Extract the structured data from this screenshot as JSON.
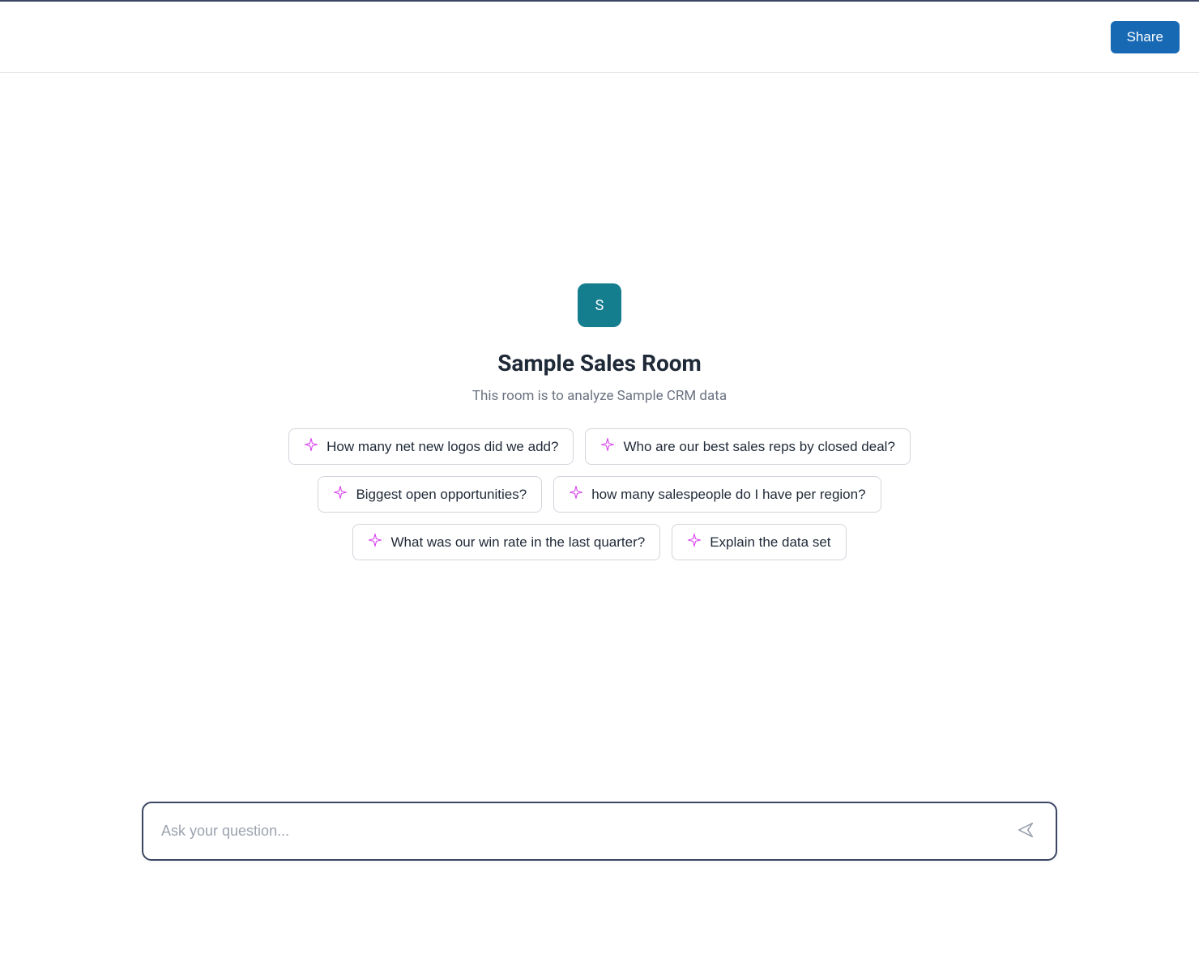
{
  "header": {
    "share_label": "Share"
  },
  "room": {
    "avatar_letter": "S",
    "title": "Sample Sales Room",
    "subtitle": "This room is to analyze Sample CRM data"
  },
  "suggestions": [
    "How many net new logos did we add?",
    "Who are our best sales reps by closed deal?",
    "Biggest open opportunities?",
    "how many salespeople do I have per region?",
    "What was our win rate in the last quarter?",
    "Explain the data set"
  ],
  "input": {
    "placeholder": "Ask your question...",
    "value": ""
  },
  "colors": {
    "primary": "#1869b4",
    "avatar_bg": "#147d8e"
  }
}
